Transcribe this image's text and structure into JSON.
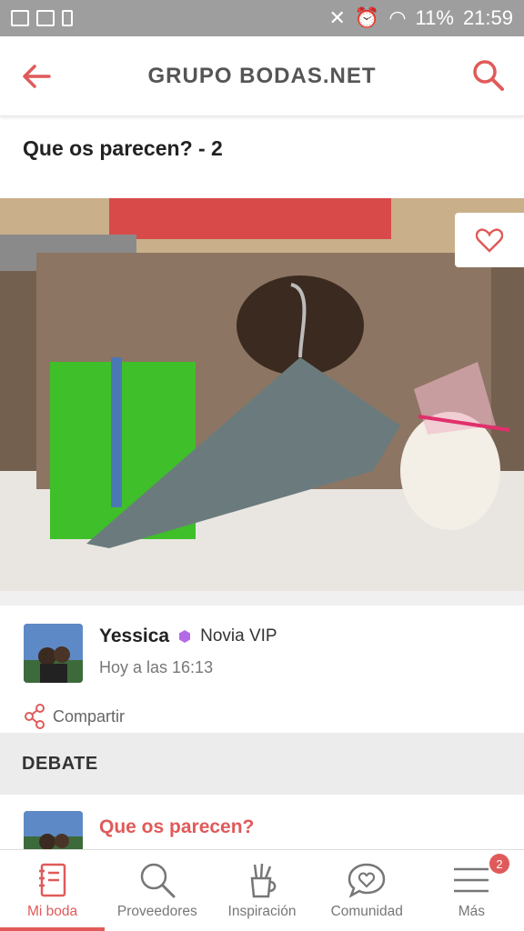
{
  "status_bar": {
    "battery": "11%",
    "time": "21:59"
  },
  "app_bar": {
    "title": "GRUPO BODAS.NET"
  },
  "post": {
    "title": "Que os parecen? - 2",
    "author": {
      "name": "Yessica",
      "badge": "Novia VIP",
      "time": "Hoy a las 16:13"
    },
    "share_label": "Compartir"
  },
  "section": {
    "label": "DEBATE"
  },
  "related": {
    "title": "Que os parecen?"
  },
  "tabs": [
    {
      "label": "Mi boda",
      "icon": "notebook-icon",
      "active": true
    },
    {
      "label": "Proveedores",
      "icon": "search-icon"
    },
    {
      "label": "Inspiración",
      "icon": "pencil-cup-icon"
    },
    {
      "label": "Comunidad",
      "icon": "chat-heart-icon"
    },
    {
      "label": "Más",
      "icon": "menu-icon",
      "badge": "2"
    }
  ],
  "colors": {
    "accent": "#e05a5a",
    "status_bar": "#9e9e9e",
    "vip": "#b46ae6"
  }
}
